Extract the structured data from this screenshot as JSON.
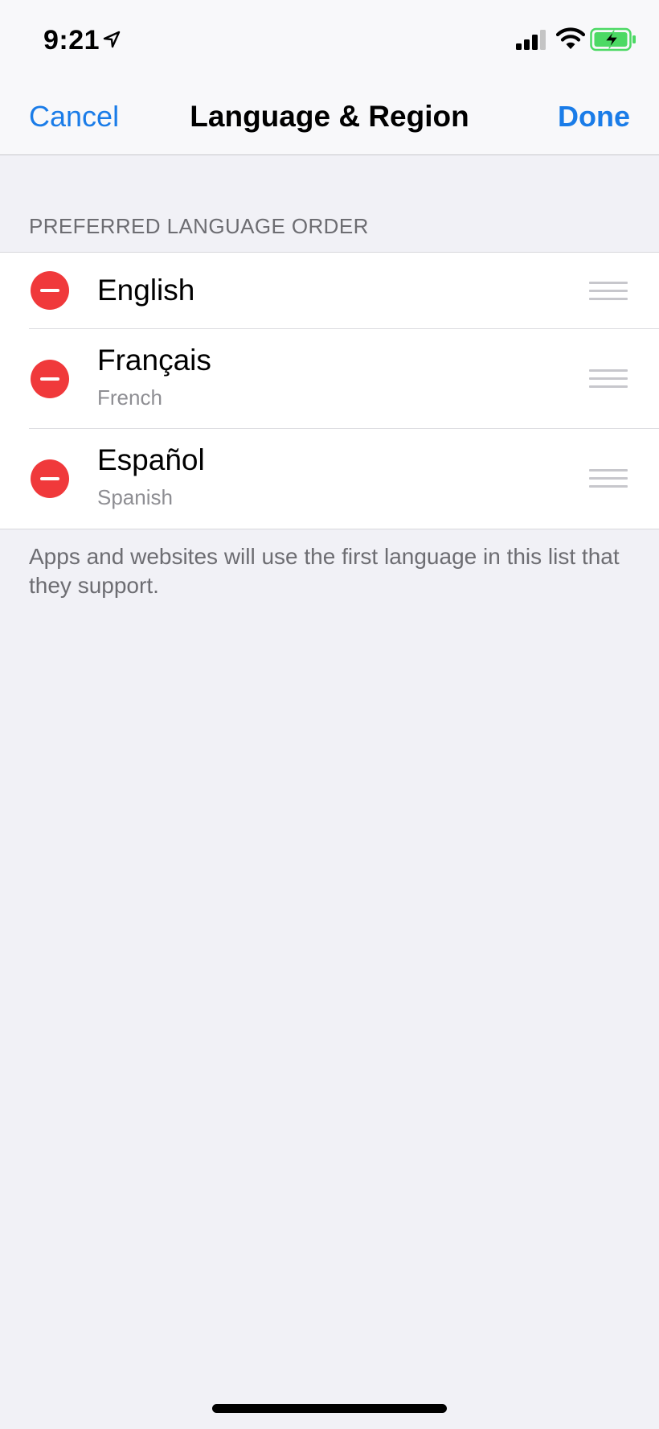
{
  "status_bar": {
    "time": "9:21",
    "icons": [
      "location-arrow-icon",
      "cellular-signal-icon",
      "wifi-icon",
      "battery-charging-icon"
    ]
  },
  "nav": {
    "cancel_label": "Cancel",
    "title": "Language & Region",
    "done_label": "Done"
  },
  "section": {
    "header": "PREFERRED LANGUAGE ORDER",
    "languages": [
      {
        "name": "English",
        "subtitle": ""
      },
      {
        "name": "Français",
        "subtitle": "French"
      },
      {
        "name": "Español",
        "subtitle": "Spanish"
      }
    ],
    "footer": "Apps and websites will use the first language in this list that they support."
  },
  "colors": {
    "accent": "#1a7ce8",
    "delete": "#f0393b",
    "background": "#f1f1f6",
    "battery": "#4cd964"
  }
}
